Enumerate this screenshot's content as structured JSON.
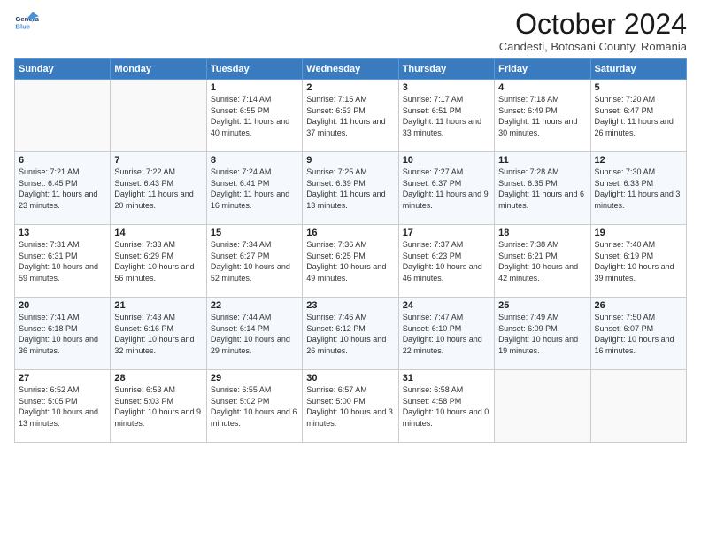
{
  "header": {
    "logo_line1": "General",
    "logo_line2": "Blue",
    "month": "October 2024",
    "location": "Candesti, Botosani County, Romania"
  },
  "weekdays": [
    "Sunday",
    "Monday",
    "Tuesday",
    "Wednesday",
    "Thursday",
    "Friday",
    "Saturday"
  ],
  "weeks": [
    [
      {
        "day": "",
        "info": ""
      },
      {
        "day": "",
        "info": ""
      },
      {
        "day": "1",
        "info": "Sunrise: 7:14 AM\nSunset: 6:55 PM\nDaylight: 11 hours and 40 minutes."
      },
      {
        "day": "2",
        "info": "Sunrise: 7:15 AM\nSunset: 6:53 PM\nDaylight: 11 hours and 37 minutes."
      },
      {
        "day": "3",
        "info": "Sunrise: 7:17 AM\nSunset: 6:51 PM\nDaylight: 11 hours and 33 minutes."
      },
      {
        "day": "4",
        "info": "Sunrise: 7:18 AM\nSunset: 6:49 PM\nDaylight: 11 hours and 30 minutes."
      },
      {
        "day": "5",
        "info": "Sunrise: 7:20 AM\nSunset: 6:47 PM\nDaylight: 11 hours and 26 minutes."
      }
    ],
    [
      {
        "day": "6",
        "info": "Sunrise: 7:21 AM\nSunset: 6:45 PM\nDaylight: 11 hours and 23 minutes."
      },
      {
        "day": "7",
        "info": "Sunrise: 7:22 AM\nSunset: 6:43 PM\nDaylight: 11 hours and 20 minutes."
      },
      {
        "day": "8",
        "info": "Sunrise: 7:24 AM\nSunset: 6:41 PM\nDaylight: 11 hours and 16 minutes."
      },
      {
        "day": "9",
        "info": "Sunrise: 7:25 AM\nSunset: 6:39 PM\nDaylight: 11 hours and 13 minutes."
      },
      {
        "day": "10",
        "info": "Sunrise: 7:27 AM\nSunset: 6:37 PM\nDaylight: 11 hours and 9 minutes."
      },
      {
        "day": "11",
        "info": "Sunrise: 7:28 AM\nSunset: 6:35 PM\nDaylight: 11 hours and 6 minutes."
      },
      {
        "day": "12",
        "info": "Sunrise: 7:30 AM\nSunset: 6:33 PM\nDaylight: 11 hours and 3 minutes."
      }
    ],
    [
      {
        "day": "13",
        "info": "Sunrise: 7:31 AM\nSunset: 6:31 PM\nDaylight: 10 hours and 59 minutes."
      },
      {
        "day": "14",
        "info": "Sunrise: 7:33 AM\nSunset: 6:29 PM\nDaylight: 10 hours and 56 minutes."
      },
      {
        "day": "15",
        "info": "Sunrise: 7:34 AM\nSunset: 6:27 PM\nDaylight: 10 hours and 52 minutes."
      },
      {
        "day": "16",
        "info": "Sunrise: 7:36 AM\nSunset: 6:25 PM\nDaylight: 10 hours and 49 minutes."
      },
      {
        "day": "17",
        "info": "Sunrise: 7:37 AM\nSunset: 6:23 PM\nDaylight: 10 hours and 46 minutes."
      },
      {
        "day": "18",
        "info": "Sunrise: 7:38 AM\nSunset: 6:21 PM\nDaylight: 10 hours and 42 minutes."
      },
      {
        "day": "19",
        "info": "Sunrise: 7:40 AM\nSunset: 6:19 PM\nDaylight: 10 hours and 39 minutes."
      }
    ],
    [
      {
        "day": "20",
        "info": "Sunrise: 7:41 AM\nSunset: 6:18 PM\nDaylight: 10 hours and 36 minutes."
      },
      {
        "day": "21",
        "info": "Sunrise: 7:43 AM\nSunset: 6:16 PM\nDaylight: 10 hours and 32 minutes."
      },
      {
        "day": "22",
        "info": "Sunrise: 7:44 AM\nSunset: 6:14 PM\nDaylight: 10 hours and 29 minutes."
      },
      {
        "day": "23",
        "info": "Sunrise: 7:46 AM\nSunset: 6:12 PM\nDaylight: 10 hours and 26 minutes."
      },
      {
        "day": "24",
        "info": "Sunrise: 7:47 AM\nSunset: 6:10 PM\nDaylight: 10 hours and 22 minutes."
      },
      {
        "day": "25",
        "info": "Sunrise: 7:49 AM\nSunset: 6:09 PM\nDaylight: 10 hours and 19 minutes."
      },
      {
        "day": "26",
        "info": "Sunrise: 7:50 AM\nSunset: 6:07 PM\nDaylight: 10 hours and 16 minutes."
      }
    ],
    [
      {
        "day": "27",
        "info": "Sunrise: 6:52 AM\nSunset: 5:05 PM\nDaylight: 10 hours and 13 minutes."
      },
      {
        "day": "28",
        "info": "Sunrise: 6:53 AM\nSunset: 5:03 PM\nDaylight: 10 hours and 9 minutes."
      },
      {
        "day": "29",
        "info": "Sunrise: 6:55 AM\nSunset: 5:02 PM\nDaylight: 10 hours and 6 minutes."
      },
      {
        "day": "30",
        "info": "Sunrise: 6:57 AM\nSunset: 5:00 PM\nDaylight: 10 hours and 3 minutes."
      },
      {
        "day": "31",
        "info": "Sunrise: 6:58 AM\nSunset: 4:58 PM\nDaylight: 10 hours and 0 minutes."
      },
      {
        "day": "",
        "info": ""
      },
      {
        "day": "",
        "info": ""
      }
    ]
  ]
}
